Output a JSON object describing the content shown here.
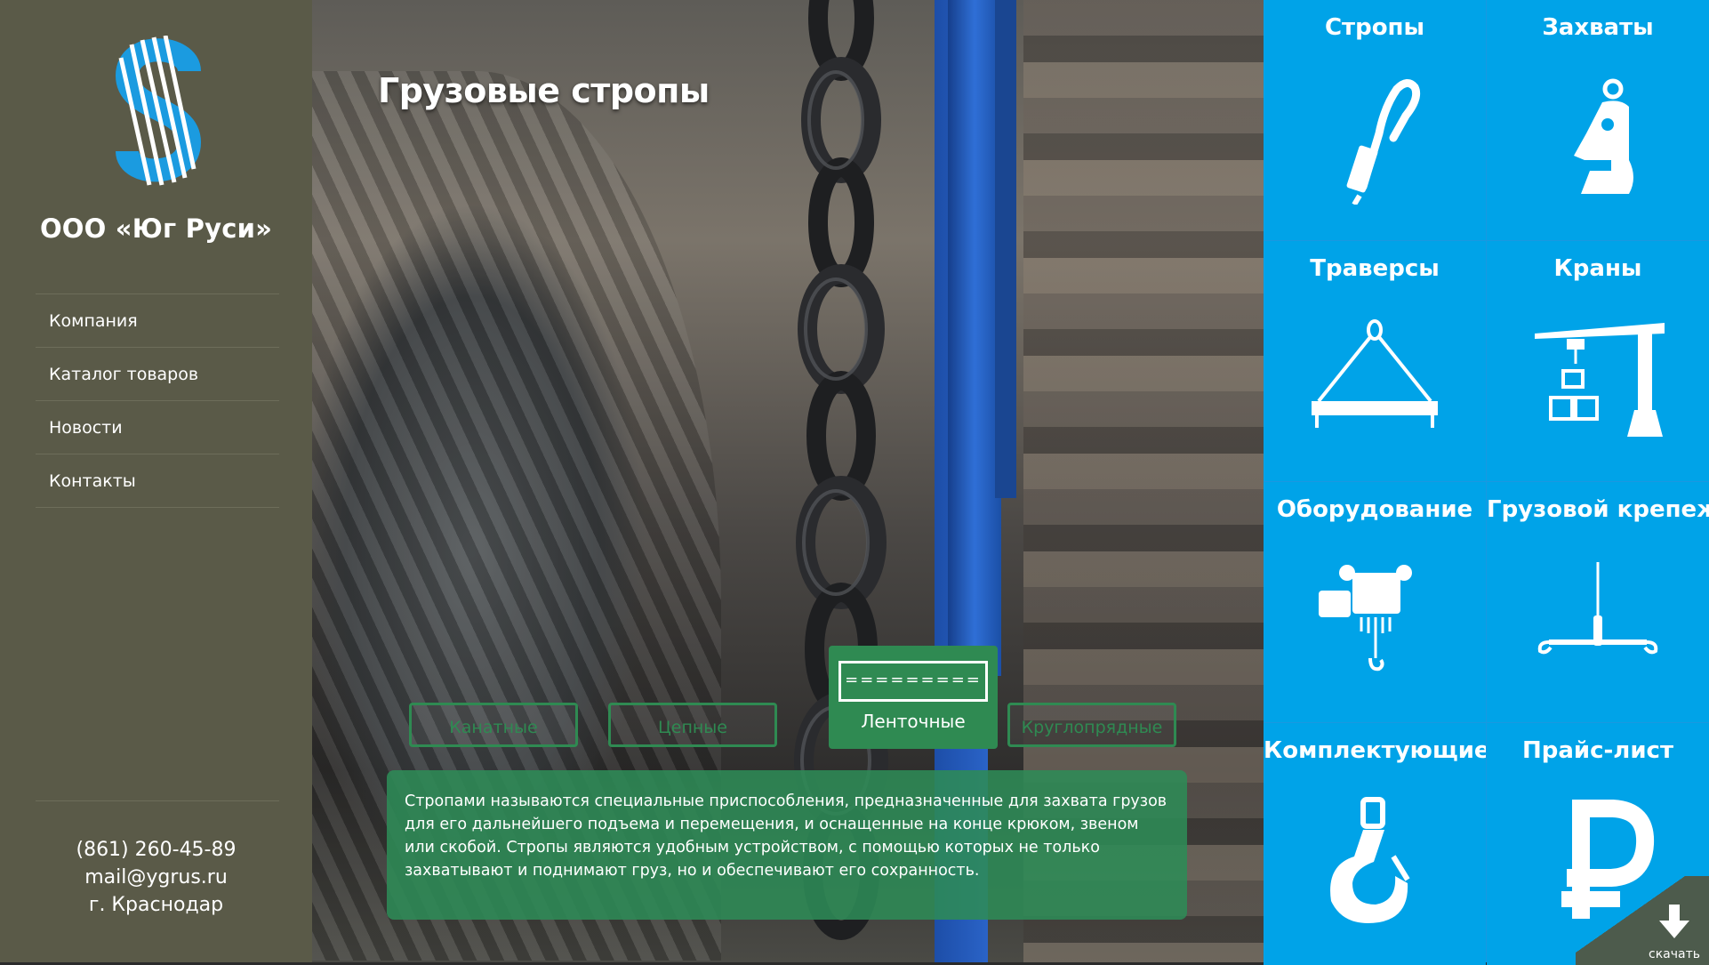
{
  "brand": {
    "company_name": "ООО «Юг Руси»",
    "logo_icon": "rope-dollar-logo-icon",
    "logo_colors": [
      "#1b9be0",
      "#ffffff"
    ]
  },
  "nav": {
    "items": [
      {
        "label": "Компания"
      },
      {
        "label": "Каталог товаров"
      },
      {
        "label": "Новости"
      },
      {
        "label": "Контакты"
      }
    ]
  },
  "contacts": {
    "phone": "(861) 260-45-89",
    "email": "mail@ygrus.ru",
    "city": "г. Краснодар"
  },
  "hero": {
    "title": "Грузовые стропы",
    "types": [
      {
        "label": "Канатные",
        "active": false
      },
      {
        "label": "Цепные",
        "active": false
      },
      {
        "label": "Ленточные",
        "active": true,
        "band_pattern": "========="
      },
      {
        "label": "Круглопрядные",
        "active": false
      }
    ],
    "description": "Стропами называются специальные приспособления, предназначенные для захвата грузов для его дальнейшего подъема и перемещения, и оснащенные на конце крюком, звеном или скобой. Стропы являются удобным  устройством, с помощью которых не только захватывают и поднимают груз, но и обеспечивают его сохранность."
  },
  "tiles": [
    {
      "label": "Стропы",
      "icon": "sling-icon"
    },
    {
      "label": "Захваты",
      "icon": "clamp-icon"
    },
    {
      "label": "Траверсы",
      "icon": "beam-icon"
    },
    {
      "label": "Краны",
      "icon": "crane-icon"
    },
    {
      "label": "Оборудование",
      "icon": "hoist-icon"
    },
    {
      "label": "Грузовой крепеж",
      "icon": "ratchet-icon"
    },
    {
      "label": "Комплектующие",
      "icon": "hook-icon"
    },
    {
      "label": "Прайс-лист",
      "icon": "ruble-icon"
    }
  ],
  "download": {
    "label": "скачать",
    "icon": "download-arrow-icon"
  },
  "colors": {
    "sidebar": "#5a5a48",
    "tiles": "#00a3e8",
    "accent_green": "#2f8a52"
  }
}
